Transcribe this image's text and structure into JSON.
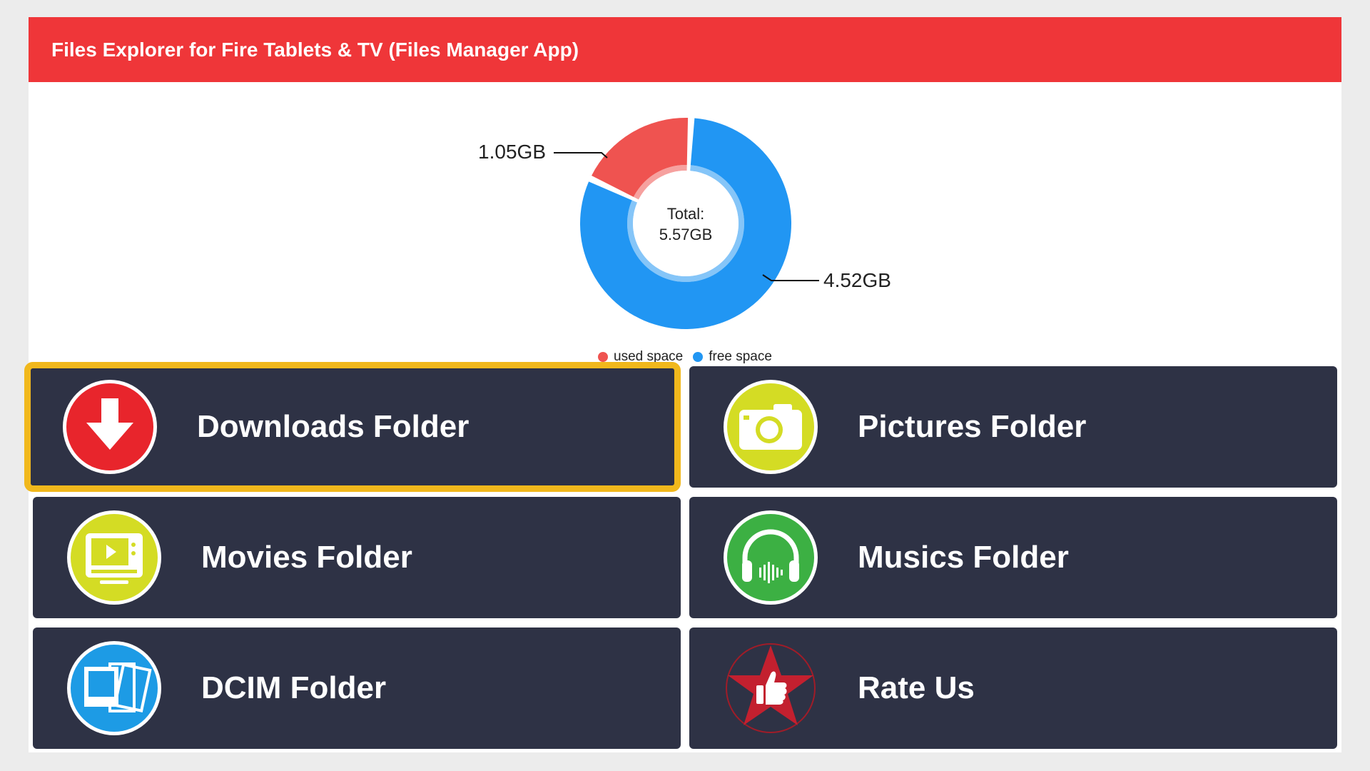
{
  "header": {
    "title": "Files Explorer for Fire Tablets & TV (Files Manager App)"
  },
  "storage": {
    "center_label_line1": "Total:",
    "center_label_line2": "5.57GB",
    "used_label": "1.05GB",
    "free_label": "4.52GB",
    "legend": [
      {
        "label": "used space",
        "color": "#ef5350"
      },
      {
        "label": "free space",
        "color": "#2196f3"
      }
    ]
  },
  "chart_data": {
    "type": "pie",
    "variant": "donut",
    "center_text": [
      "Total:",
      "5.57GB"
    ],
    "categories": [
      "used space",
      "free space"
    ],
    "values": [
      1.05,
      4.52
    ],
    "data_labels": [
      "1.05GB",
      "4.52GB"
    ],
    "unit": "GB",
    "colors": [
      "#ef5350",
      "#2196f3"
    ],
    "legend_position": "bottom-center"
  },
  "tiles": [
    {
      "label": "Downloads Folder",
      "icon": "download-arrow-icon",
      "focused": true
    },
    {
      "label": "Pictures Folder",
      "icon": "camera-icon",
      "focused": false
    },
    {
      "label": "Movies Folder",
      "icon": "video-player-icon",
      "focused": false
    },
    {
      "label": "Musics Folder",
      "icon": "headphones-icon",
      "focused": false
    },
    {
      "label": "DCIM Folder",
      "icon": "photos-stack-icon",
      "focused": false
    },
    {
      "label": "Rate Us",
      "icon": "star-thumbs-up-icon",
      "focused": false
    }
  ],
  "colors": {
    "header": "#ef3639",
    "tile_bg": "#2e3245",
    "focus_border": "#f1b81c",
    "used": "#ef5350",
    "free": "#2196f3"
  }
}
